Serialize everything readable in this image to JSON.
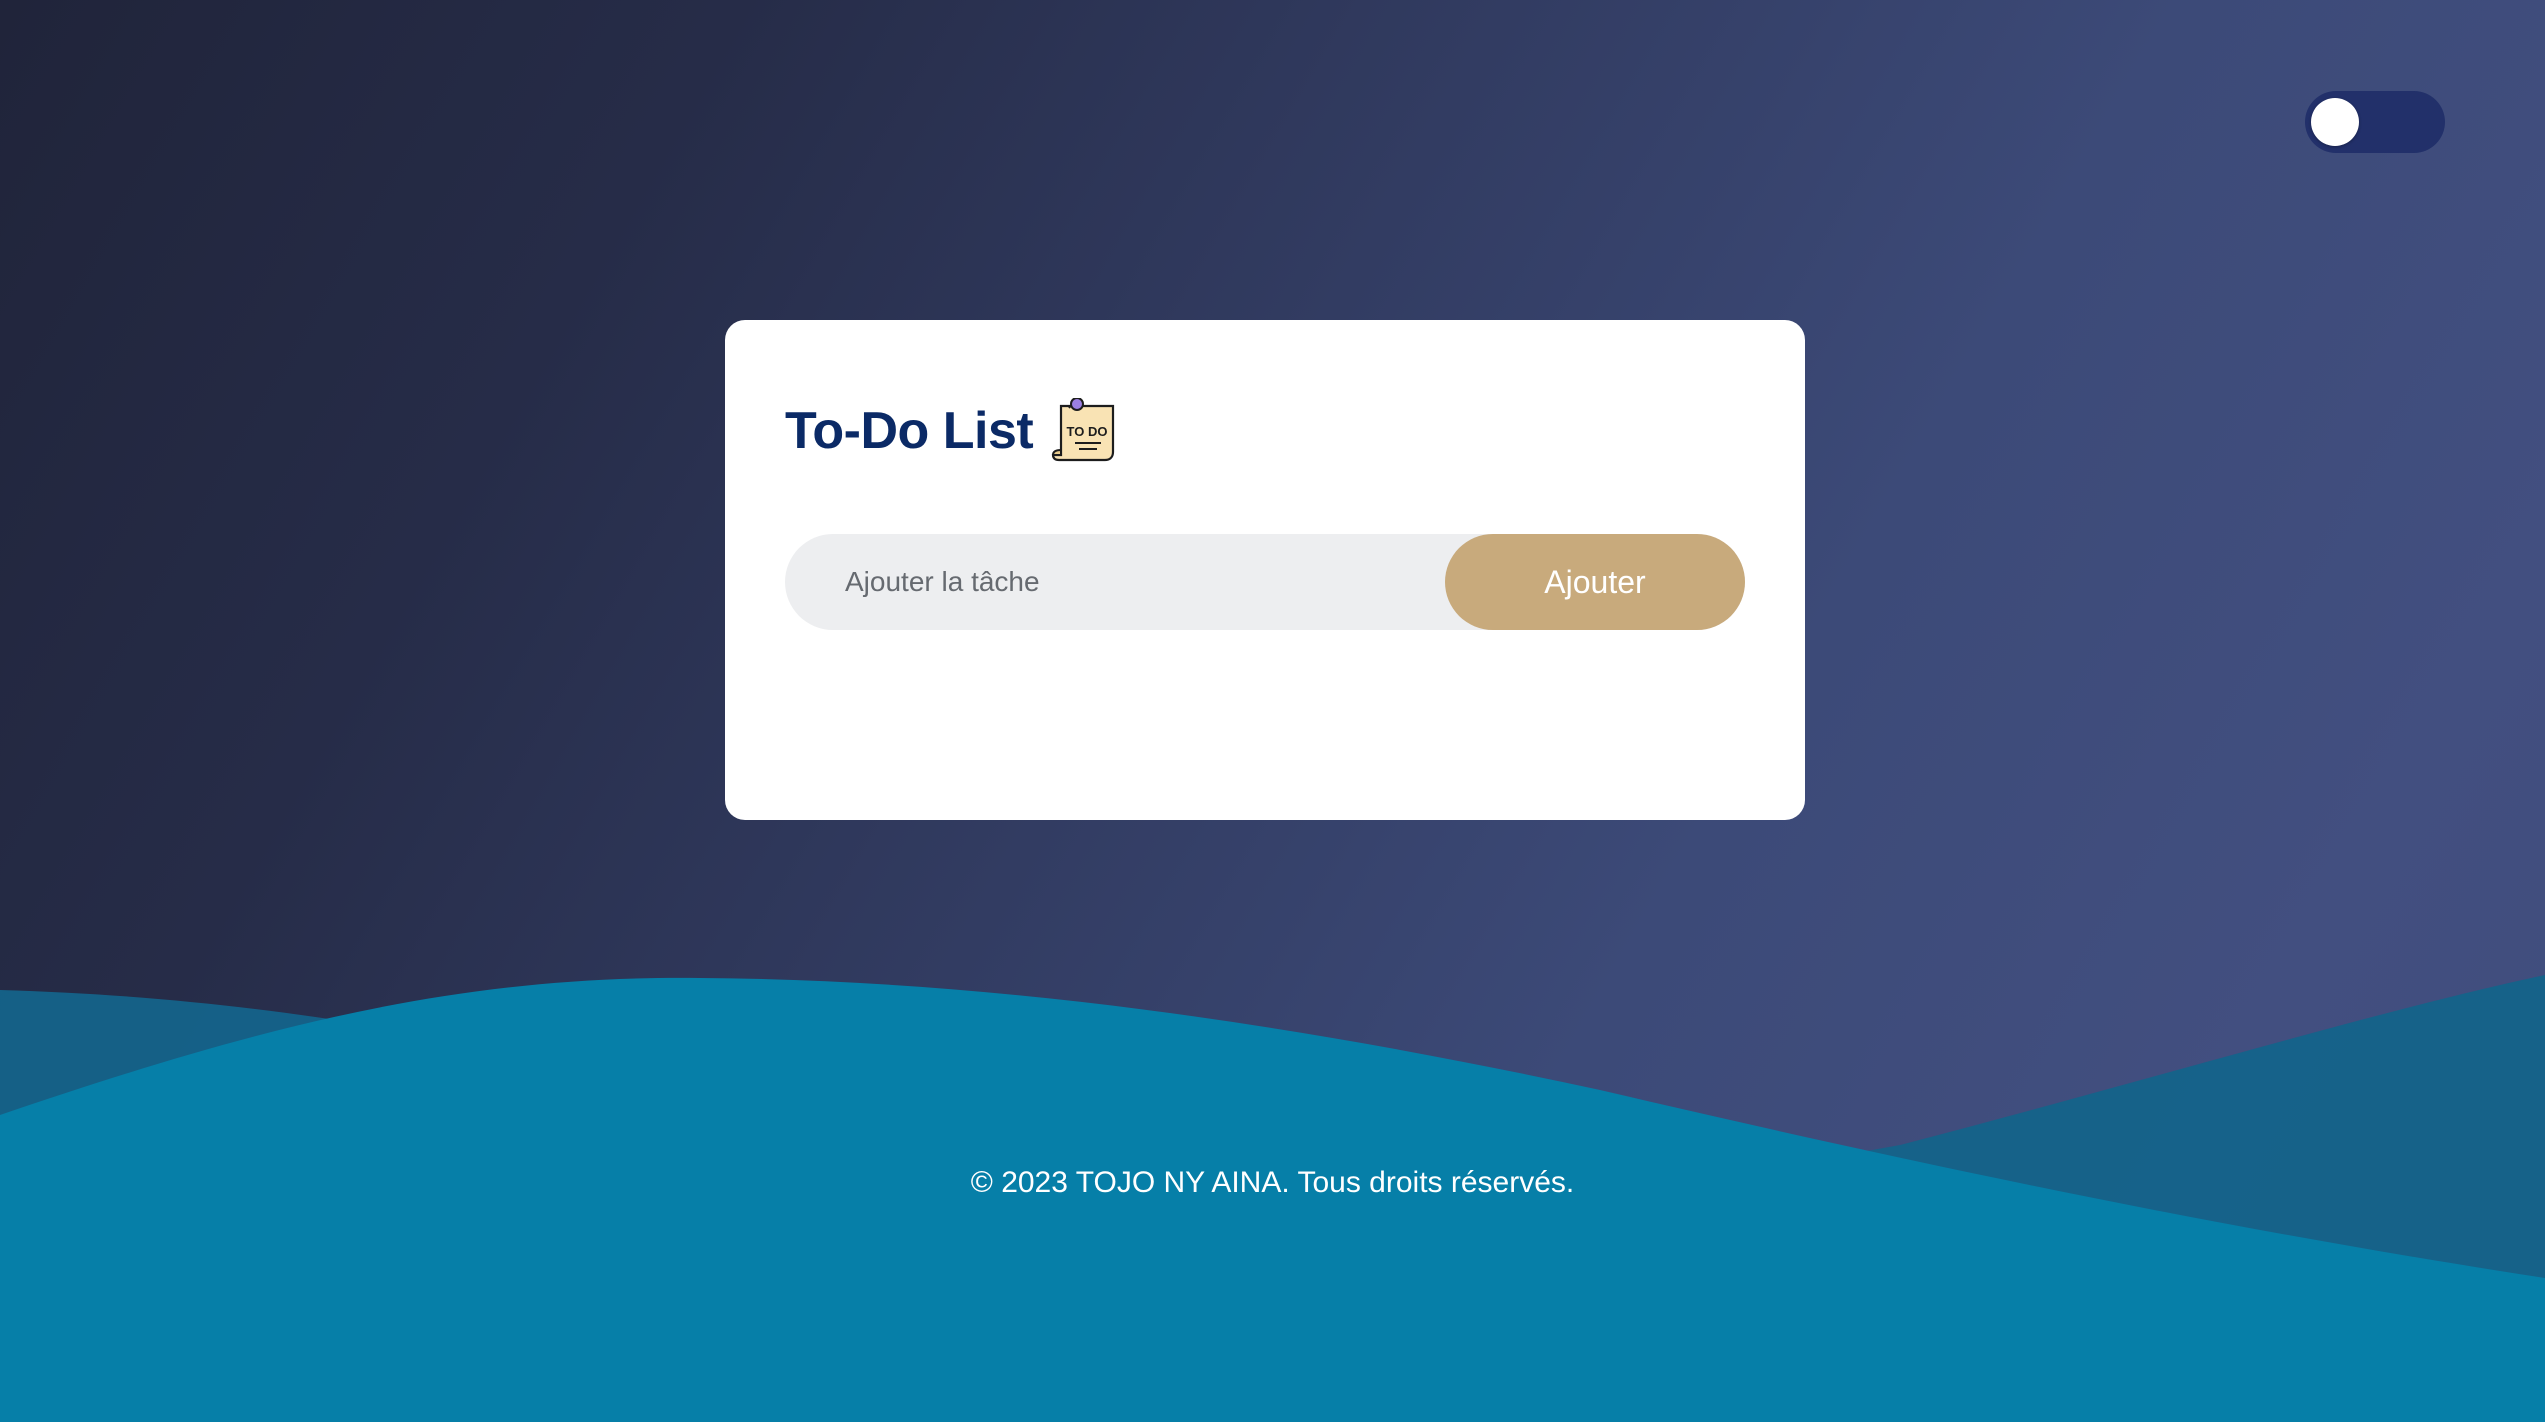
{
  "colors": {
    "background_dark": "#20243a",
    "background_light": "#424f80",
    "wave_primary": "#067fa8",
    "wave_secondary": "#14638a",
    "card": "#ffffff",
    "title": "#0b2a66",
    "button": "#c8aa7c",
    "input_bg": "#edeef0",
    "toggle_track": "#22306a"
  },
  "theme_toggle": {
    "state": "off",
    "icon": "toggle-switch-icon"
  },
  "card": {
    "title": "To-Do List",
    "icon": "todo-note-icon",
    "icon_text": "TO DO"
  },
  "task_form": {
    "input_placeholder": "Ajouter la tâche",
    "input_value": "",
    "add_label": "Ajouter"
  },
  "footer": {
    "copyright": "© 2023 TOJO NY AINA. Tous droits réservés."
  }
}
